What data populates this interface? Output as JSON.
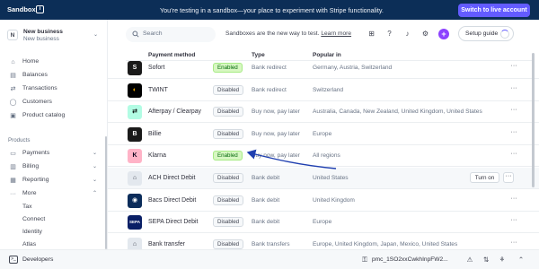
{
  "topbar": {
    "sandbox_label": "Sandbox",
    "banner": "You’re testing in a sandbox—your place to experiment with Stripe functionality.",
    "live_button": "Switch to live account"
  },
  "account": {
    "initial": "N",
    "name": "New business",
    "subtitle": "New business"
  },
  "sidebar": {
    "items": [
      {
        "label": "Home",
        "icon": "home-icon"
      },
      {
        "label": "Balances",
        "icon": "balances-icon"
      },
      {
        "label": "Transactions",
        "icon": "transactions-icon"
      },
      {
        "label": "Customers",
        "icon": "customers-icon"
      },
      {
        "label": "Product catalog",
        "icon": "catalog-icon"
      }
    ],
    "products_heading": "Products",
    "product_items": [
      {
        "label": "Payments",
        "icon": "payments-icon"
      },
      {
        "label": "Billing",
        "icon": "billing-icon"
      },
      {
        "label": "Reporting",
        "icon": "reporting-icon"
      },
      {
        "label": "More",
        "icon": "more-icon"
      }
    ],
    "sub_items": [
      "Tax",
      "Connect",
      "Identity",
      "Atlas"
    ]
  },
  "header": {
    "search_placeholder": "Search",
    "message": "Sandboxes are the new way to test.",
    "learn_more": "Learn more",
    "setup_guide": "Setup guide",
    "icons": [
      "apps-icon",
      "help-icon",
      "bell-icon",
      "gear-icon",
      "plus-icon"
    ]
  },
  "table": {
    "headers": [
      "Payment method",
      "Type",
      "Popular in"
    ],
    "rows": [
      {
        "name": "Sofort",
        "status": "Enabled",
        "type": "Bank redirect",
        "popular": "Germany, Austria, Switzerland",
        "logo_bg": "#1a1a1a",
        "logo_fg": "#ffffff",
        "logo_text": "S"
      },
      {
        "name": "TWINT",
        "status": "Disabled",
        "type": "Bank redirect",
        "popular": "Switzerland",
        "logo_bg": "#000000",
        "logo_fg": "#ffb300",
        "logo_text": "◐"
      },
      {
        "name": "Afterpay / Clearpay",
        "status": "Disabled",
        "type": "Buy now, pay later",
        "popular": "Australia, Canada, New Zealand, United Kingdom, United States",
        "logo_bg": "#b2fce4",
        "logo_fg": "#000000",
        "logo_text": "⇄"
      },
      {
        "name": "Billie",
        "status": "Disabled",
        "type": "Buy now, pay later",
        "popular": "Europe",
        "logo_bg": "#1a1a1a",
        "logo_fg": "#ffffff",
        "logo_text": "B"
      },
      {
        "name": "Klarna",
        "status": "Enabled",
        "type": "Buy now, pay later",
        "popular": "All regions",
        "logo_bg": "#ffb3c7",
        "logo_fg": "#0b051d",
        "logo_text": "K"
      },
      {
        "name": "ACH Direct Debit",
        "status": "Disabled",
        "type": "Bank debit",
        "popular": "United States",
        "logo_bg": "#e3e8ee",
        "logo_fg": "#414552",
        "logo_text": "⌂",
        "turn_on": "Turn on",
        "highlighted": true
      },
      {
        "name": "Bacs Direct Debit",
        "status": "Disabled",
        "type": "Bank debit",
        "popular": "United Kingdom",
        "logo_bg": "#0b2c5a",
        "logo_fg": "#ffffff",
        "logo_text": "◉"
      },
      {
        "name": "SEPA Direct Debit",
        "status": "Disabled",
        "type": "Bank debit",
        "popular": "Europe",
        "logo_bg": "#0a1f66",
        "logo_fg": "#ffffff",
        "logo_text": "SEPA"
      },
      {
        "name": "Bank transfer",
        "status": "Disabled",
        "type": "Bank transfers",
        "popular": "Europe, United Kingdom, Japan, Mexico, United States",
        "logo_bg": "#e3e8ee",
        "logo_fg": "#414552",
        "logo_text": "⌂"
      }
    ]
  },
  "footer": {
    "developers": "Developers",
    "pmc_id": "pmc_1SO2xxCwkhInpFW2..."
  }
}
